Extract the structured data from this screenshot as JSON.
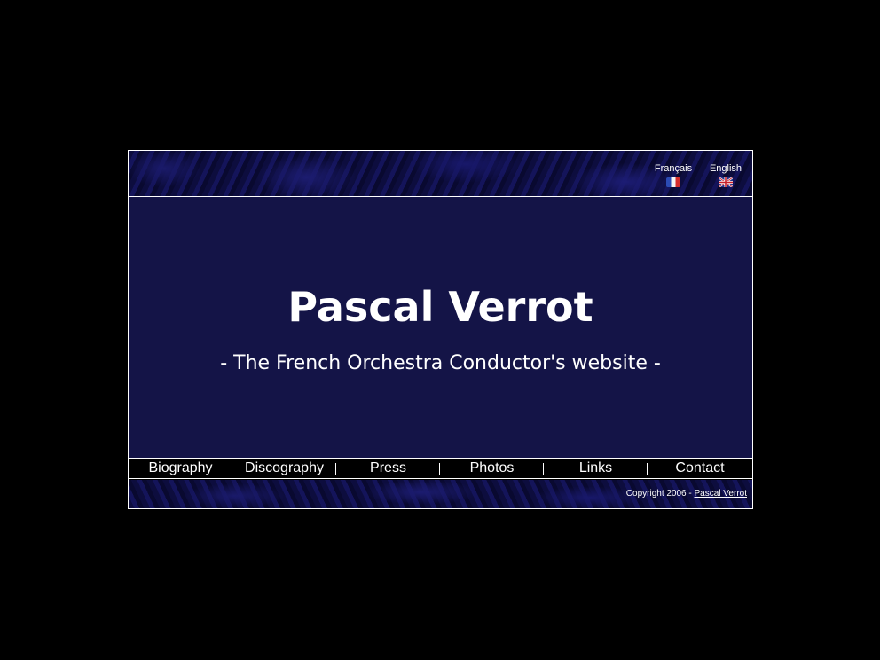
{
  "languages": [
    {
      "label": "Français",
      "flag": "france-flag-icon"
    },
    {
      "label": "English",
      "flag": "uk-flag-icon"
    }
  ],
  "hero": {
    "title": "Pascal Verrot",
    "subtitle": "- The French Orchestra Conductor's website -"
  },
  "nav": {
    "items": [
      "Biography",
      "Discography",
      "Press",
      "Photos",
      "Links",
      "Contact"
    ]
  },
  "footer": {
    "copyright_text": "Copyright 2006 - ",
    "copyright_link": "Pascal Verrot"
  },
  "colors": {
    "page_background": "#000000",
    "hero_background": "#141447",
    "text": "#ffffff",
    "border": "#ffffff"
  }
}
